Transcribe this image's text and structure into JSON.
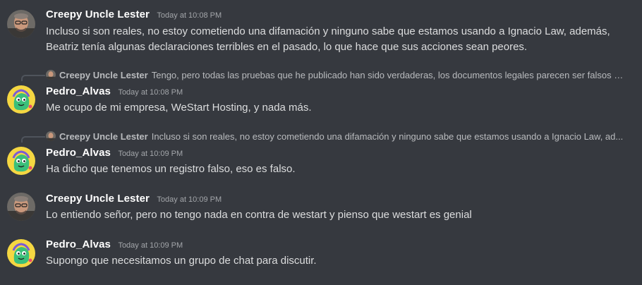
{
  "messages": [
    {
      "author": "Creepy Uncle Lester",
      "timestamp": "Today at 10:08 PM",
      "avatar_icon": "man-portrait-avatar",
      "text": "Incluso si son reales, no estoy cometiendo una difamación y ninguno sabe que estamos usando a Ignacio Law, además, Beatriz tenía algunas declaraciones terribles en el pasado, lo que hace que sus acciones sean peores."
    },
    {
      "reply": {
        "author": "Creepy Uncle Lester",
        "text": "Tengo, pero todas las pruebas que he publicado han sido verdaderas, los documentos legales parecen ser falsos y ..."
      },
      "author": "Pedro_Alvas",
      "timestamp": "Today at 10:08 PM",
      "avatar_icon": "green-cartoon-avatar",
      "text": "Me ocupo de mi empresa, WeStart Hosting, y nada más."
    },
    {
      "reply": {
        "author": "Creepy Uncle Lester",
        "text": "Incluso si son reales, no estoy cometiendo una difamación y ninguno sabe que estamos usando a Ignacio Law, ad..."
      },
      "author": "Pedro_Alvas",
      "timestamp": "Today at 10:09 PM",
      "avatar_icon": "green-cartoon-avatar",
      "text": "Ha dicho que tenemos un registro falso, eso es falso."
    },
    {
      "author": "Creepy Uncle Lester",
      "timestamp": "Today at 10:09 PM",
      "avatar_icon": "man-portrait-avatar",
      "text": "Lo entiendo señor, pero no tengo nada en contra de westart y pienso que westart es genial"
    },
    {
      "author": "Pedro_Alvas",
      "timestamp": "Today at 10:09 PM",
      "avatar_icon": "green-cartoon-avatar",
      "text": "Supongo que necesitamos un grupo de chat para discutir."
    }
  ],
  "colors": {
    "background": "#36393f",
    "username": "#ffffff",
    "text": "#dcddde",
    "muted": "#a3a6aa",
    "avatar_yellow": "#f5d742",
    "avatar_green": "#3bbf7a"
  }
}
